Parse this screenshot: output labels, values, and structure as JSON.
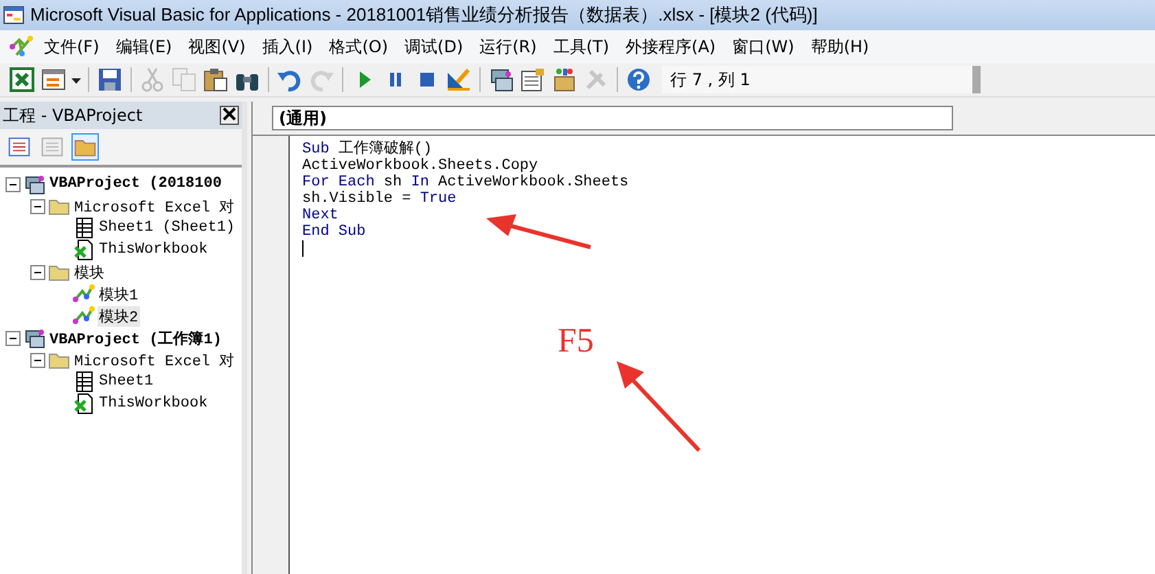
{
  "window": {
    "title": "Microsoft Visual Basic for Applications - 20181001销售业绩分析报告（数据表）.xlsx - [模块2 (代码)]"
  },
  "menu": [
    "文件(F)",
    "编辑(E)",
    "视图(V)",
    "插入(I)",
    "格式(O)",
    "调试(D)",
    "运行(R)",
    "工具(T)",
    "外接程序(A)",
    "窗口(W)",
    "帮助(H)"
  ],
  "toolbar": {
    "buttons": [
      {
        "disabled": false
      },
      {
        "disabled": false
      },
      {
        "disabled": false
      },
      {
        "disabled": true
      },
      {
        "disabled": true
      },
      {
        "disabled": false
      },
      {
        "disabled": false
      },
      {
        "disabled": false
      },
      {
        "disabled": true
      },
      {
        "disabled": false
      },
      {
        "disabled": false
      },
      {
        "disabled": false
      },
      {
        "disabled": false
      },
      {
        "disabled": false
      },
      {
        "disabled": false
      },
      {
        "disabled": false
      },
      {
        "disabled": true
      },
      {
        "disabled": false
      }
    ],
    "position": "行 7 , 列 1"
  },
  "project_panel": {
    "title": "工程 - VBAProject",
    "tree": [
      {
        "kind": "project",
        "label": "VBAProject (2018100",
        "expanded": true,
        "selected": false,
        "children": [
          {
            "kind": "folder",
            "label": "Microsoft Excel 对",
            "expanded": true,
            "selected": false,
            "children": [
              {
                "kind": "sheet",
                "label": "Sheet1 (Sheet1)",
                "selected": false
              },
              {
                "kind": "workbook",
                "label": "ThisWorkbook",
                "selected": false
              }
            ]
          },
          {
            "kind": "folder",
            "label": "模块",
            "expanded": true,
            "selected": false,
            "children": [
              {
                "kind": "module",
                "label": "模块1",
                "selected": false
              },
              {
                "kind": "module",
                "label": "模块2",
                "selected": true
              }
            ]
          }
        ]
      },
      {
        "kind": "project",
        "label": "VBAProject (工作簿1)",
        "expanded": true,
        "selected": false,
        "children": [
          {
            "kind": "folder",
            "label": "Microsoft Excel 对",
            "expanded": true,
            "selected": false,
            "children": [
              {
                "kind": "sheet",
                "label": "Sheet1",
                "selected": false
              },
              {
                "kind": "workbook",
                "label": "ThisWorkbook",
                "selected": false
              }
            ]
          }
        ]
      }
    ]
  },
  "code_window": {
    "object": "(通用)",
    "lines": [
      [
        {
          "kind": "keyword",
          "text": "Sub"
        },
        {
          "kind": "plain",
          "text": " 工作簿破解()"
        }
      ],
      [
        {
          "kind": "plain",
          "text": "ActiveWorkbook.Sheets.Copy"
        }
      ],
      [
        {
          "kind": "keyword",
          "text": "For Each"
        },
        {
          "kind": "plain",
          "text": " sh "
        },
        {
          "kind": "keyword",
          "text": "In"
        },
        {
          "kind": "plain",
          "text": " ActiveWorkbook.Sheets"
        }
      ],
      [
        {
          "kind": "plain",
          "text": "sh.Visible = "
        },
        {
          "kind": "keyword",
          "text": "True"
        }
      ],
      [
        {
          "kind": "keyword",
          "text": "Next"
        }
      ],
      [
        {
          "kind": "keyword",
          "text": "End Sub"
        }
      ]
    ]
  },
  "annotation": {
    "label": "F5"
  }
}
